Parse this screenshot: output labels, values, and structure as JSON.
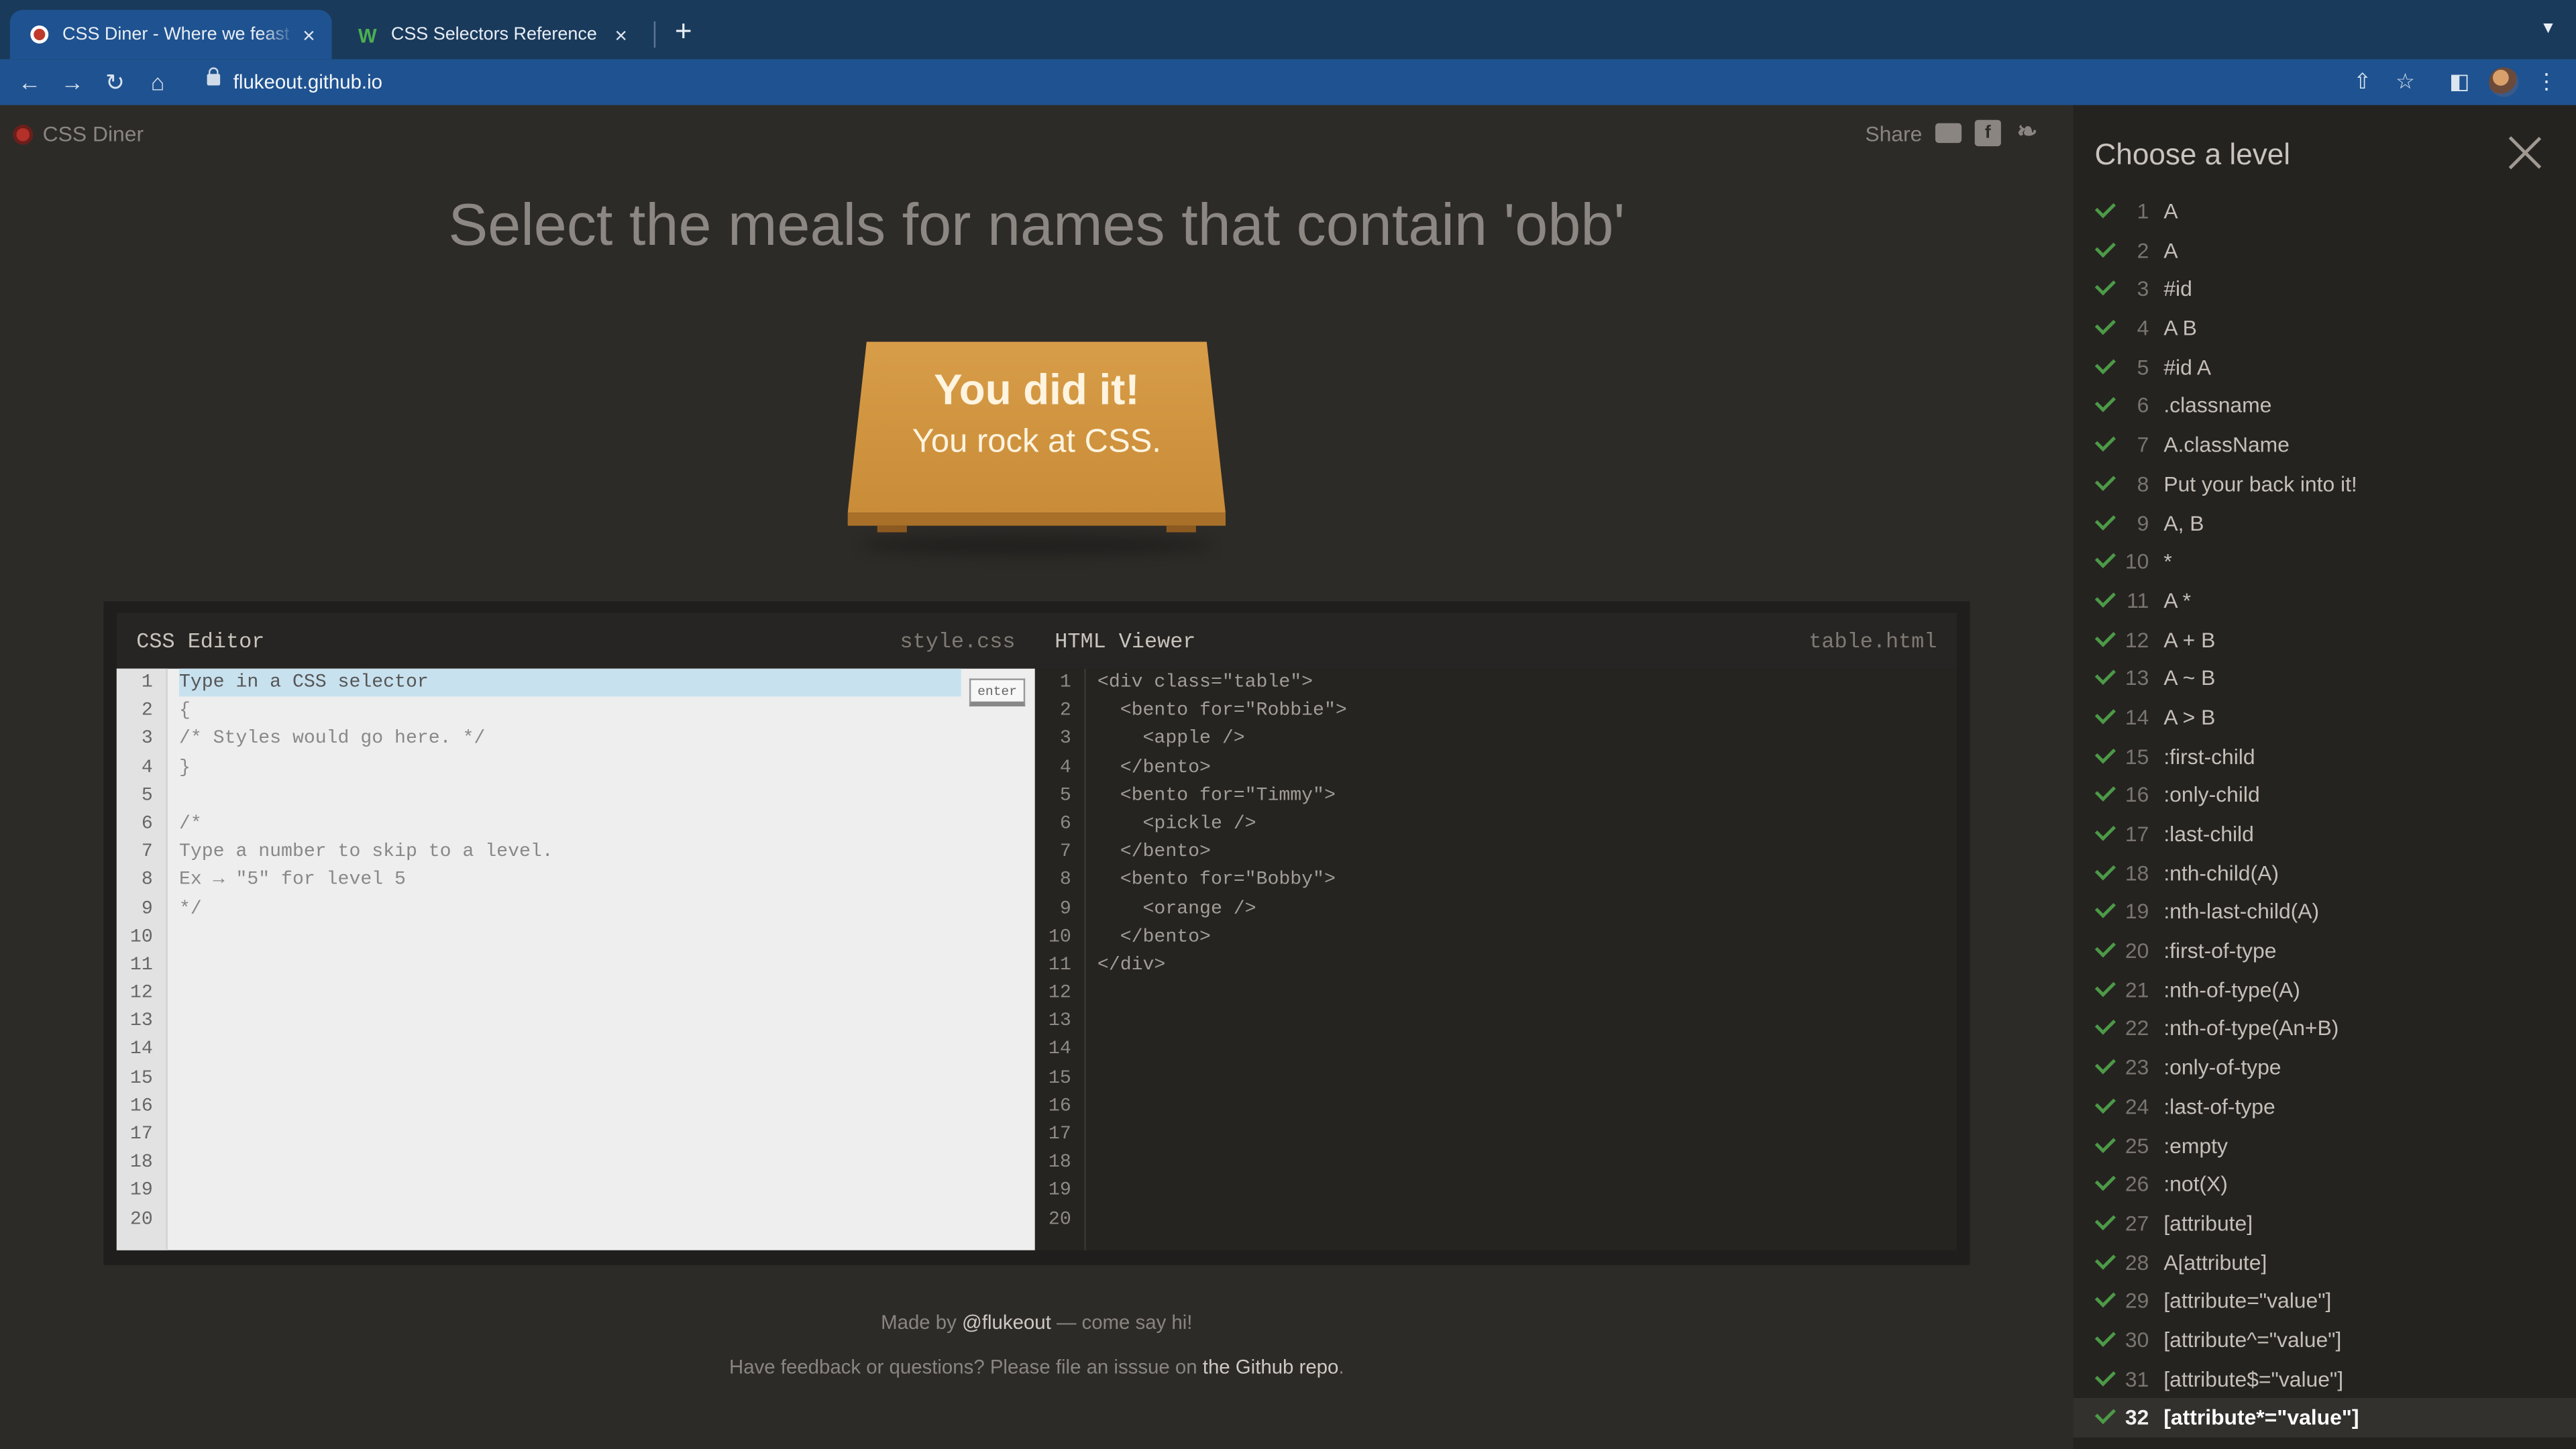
{
  "browser": {
    "tabs": [
      {
        "title": "CSS Diner - Where we feast on CSS",
        "close": "×"
      },
      {
        "title": "CSS Selectors Reference",
        "close": "×"
      }
    ],
    "new_tab": "+",
    "url": "flukeout.github.io"
  },
  "app": {
    "logo_text": "CSS Diner",
    "share_label": "Share",
    "instruction": "Select the meals for names that contain 'obb'",
    "win_line1": "You did it!",
    "win_line2": "You rock at CSS."
  },
  "css_editor": {
    "title": "CSS Editor",
    "filename": "style.css",
    "enter_label": "enter",
    "lines": [
      "1",
      "2",
      "3",
      "4",
      "5",
      "6",
      "7",
      "8",
      "9",
      "10",
      "11",
      "12",
      "13",
      "14",
      "15",
      "16",
      "17",
      "18",
      "19",
      "20"
    ],
    "code": [
      "Type in a CSS selector",
      "{",
      "/* Styles would go here. */",
      "}",
      "",
      "/*",
      "Type a number to skip to a level.",
      "Ex → \"5\" for level 5",
      "*/"
    ]
  },
  "html_viewer": {
    "title": "HTML Viewer",
    "filename": "table.html",
    "lines": [
      "1",
      "2",
      "3",
      "4",
      "5",
      "6",
      "7",
      "8",
      "9",
      "10",
      "11",
      "12",
      "13",
      "14",
      "15",
      "16",
      "17",
      "18",
      "19",
      "20"
    ],
    "code": [
      "<div class=\"table\">",
      "  <bento for=\"Robbie\">",
      "    <apple />",
      "  </bento>",
      "  <bento for=\"Timmy\">",
      "    <pickle />",
      "  </bento>",
      "  <bento for=\"Bobby\">",
      "    <orange />",
      "  </bento>",
      "</div>"
    ]
  },
  "footer": {
    "made_by_pre": "Made by ",
    "made_by_link": "@flukeout",
    "made_by_post": " — come say hi!",
    "feedback_pre": "Have feedback or questions? Please file an isssue on ",
    "feedback_link": "the Github repo",
    "feedback_post": "."
  },
  "sidebar": {
    "title": "Choose a level",
    "current_level": 32,
    "levels": [
      {
        "n": "1",
        "name": "A"
      },
      {
        "n": "2",
        "name": "A"
      },
      {
        "n": "3",
        "name": "#id"
      },
      {
        "n": "4",
        "name": "A  B"
      },
      {
        "n": "5",
        "name": "#id  A"
      },
      {
        "n": "6",
        "name": ".classname"
      },
      {
        "n": "7",
        "name": "A.className"
      },
      {
        "n": "8",
        "name": "Put your back into it!"
      },
      {
        "n": "9",
        "name": "A, B"
      },
      {
        "n": "10",
        "name": "*"
      },
      {
        "n": "11",
        "name": "A  *"
      },
      {
        "n": "12",
        "name": "A + B"
      },
      {
        "n": "13",
        "name": "A ~ B"
      },
      {
        "n": "14",
        "name": "A > B"
      },
      {
        "n": "15",
        "name": ":first-child"
      },
      {
        "n": "16",
        "name": ":only-child"
      },
      {
        "n": "17",
        "name": ":last-child"
      },
      {
        "n": "18",
        "name": ":nth-child(A)"
      },
      {
        "n": "19",
        "name": ":nth-last-child(A)"
      },
      {
        "n": "20",
        "name": ":first-of-type"
      },
      {
        "n": "21",
        "name": ":nth-of-type(A)"
      },
      {
        "n": "22",
        "name": ":nth-of-type(An+B)"
      },
      {
        "n": "23",
        "name": ":only-of-type"
      },
      {
        "n": "24",
        "name": ":last-of-type"
      },
      {
        "n": "25",
        "name": ":empty"
      },
      {
        "n": "26",
        "name": ":not(X)"
      },
      {
        "n": "27",
        "name": "[attribute]"
      },
      {
        "n": "28",
        "name": "A[attribute]"
      },
      {
        "n": "29",
        "name": "[attribute=\"value\"]"
      },
      {
        "n": "30",
        "name": "[attribute^=\"value\"]"
      },
      {
        "n": "31",
        "name": "[attribute$=\"value\"]"
      },
      {
        "n": "32",
        "name": "[attribute*=\"value\"]"
      }
    ]
  },
  "colors": {
    "page_bg": "#2d2b28",
    "sidebar_bg": "#252320",
    "table_orange": "#d39a45",
    "check_green": "#4c9a47",
    "browser_blue": "#1f5290"
  }
}
